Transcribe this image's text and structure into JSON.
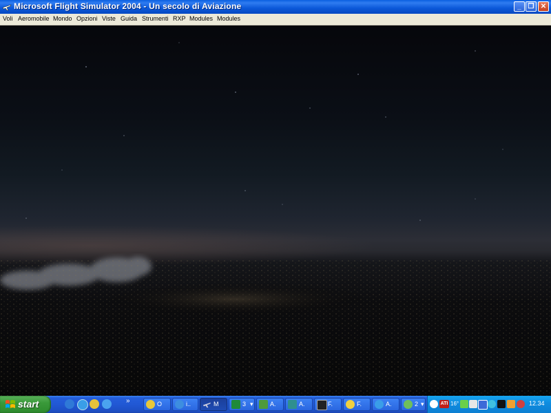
{
  "window": {
    "title": "Microsoft Flight Simulator 2004 - Un secolo di Aviazione",
    "app_icon": "plane-icon",
    "minimize_glyph": "_",
    "maximize_glyph": "❐",
    "close_glyph": "✕"
  },
  "menu": {
    "items": [
      "Voli",
      "Aeromobile",
      "Mondo",
      "Opzioni",
      "Viste",
      "Guida",
      "Strumenti",
      "RXP",
      "Modules",
      "Modules"
    ]
  },
  "taskbar": {
    "start_label": "start",
    "quicklaunch_chevron": "»",
    "tasks": [
      {
        "label": "O",
        "icon": "app-icon-yellow"
      },
      {
        "label": "i..",
        "icon": "browser-icon"
      },
      {
        "label": "M",
        "icon": "plane-icon",
        "active": true
      },
      {
        "label": "3",
        "icon": "excel-icon",
        "arrow": "▾"
      },
      {
        "label": "A.",
        "icon": "green-app-icon"
      },
      {
        "label": "A.",
        "icon": "teal-app-icon"
      },
      {
        "label": "F.",
        "icon": "terminal-icon"
      },
      {
        "label": "F.",
        "icon": "yellow-circle-icon"
      },
      {
        "label": "A.",
        "icon": "ie-icon"
      },
      {
        "label": "2",
        "icon": "group-icon",
        "arrow": "▾"
      }
    ],
    "tray": {
      "ati_label": "ATI",
      "temp_label": "16°",
      "clock": "12.34"
    }
  },
  "colors": {
    "titlebar": "#0b58d8",
    "menubar": "#ece9d8",
    "taskbar": "#245edb",
    "start": "#3a9a3a",
    "tray": "#0f8ee1"
  }
}
